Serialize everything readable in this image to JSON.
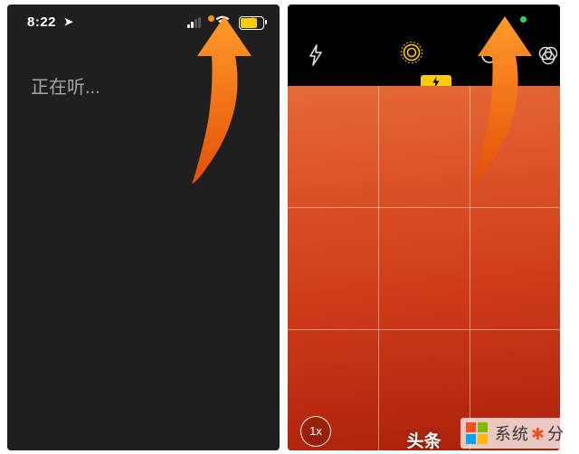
{
  "left": {
    "status_time": "8:22",
    "indicator": "orange",
    "listening_text": "正在听..."
  },
  "right": {
    "indicator": "green",
    "flash_badge_glyph": "⚡",
    "zoom_label": "1x",
    "caption_text": "头条"
  },
  "icons": {
    "location": "➤",
    "wifi": "☲",
    "flash": "⚡",
    "timer": "⏲",
    "filters": "⚙"
  },
  "watermark": {
    "text_a": "系统",
    "text_b": "分"
  }
}
